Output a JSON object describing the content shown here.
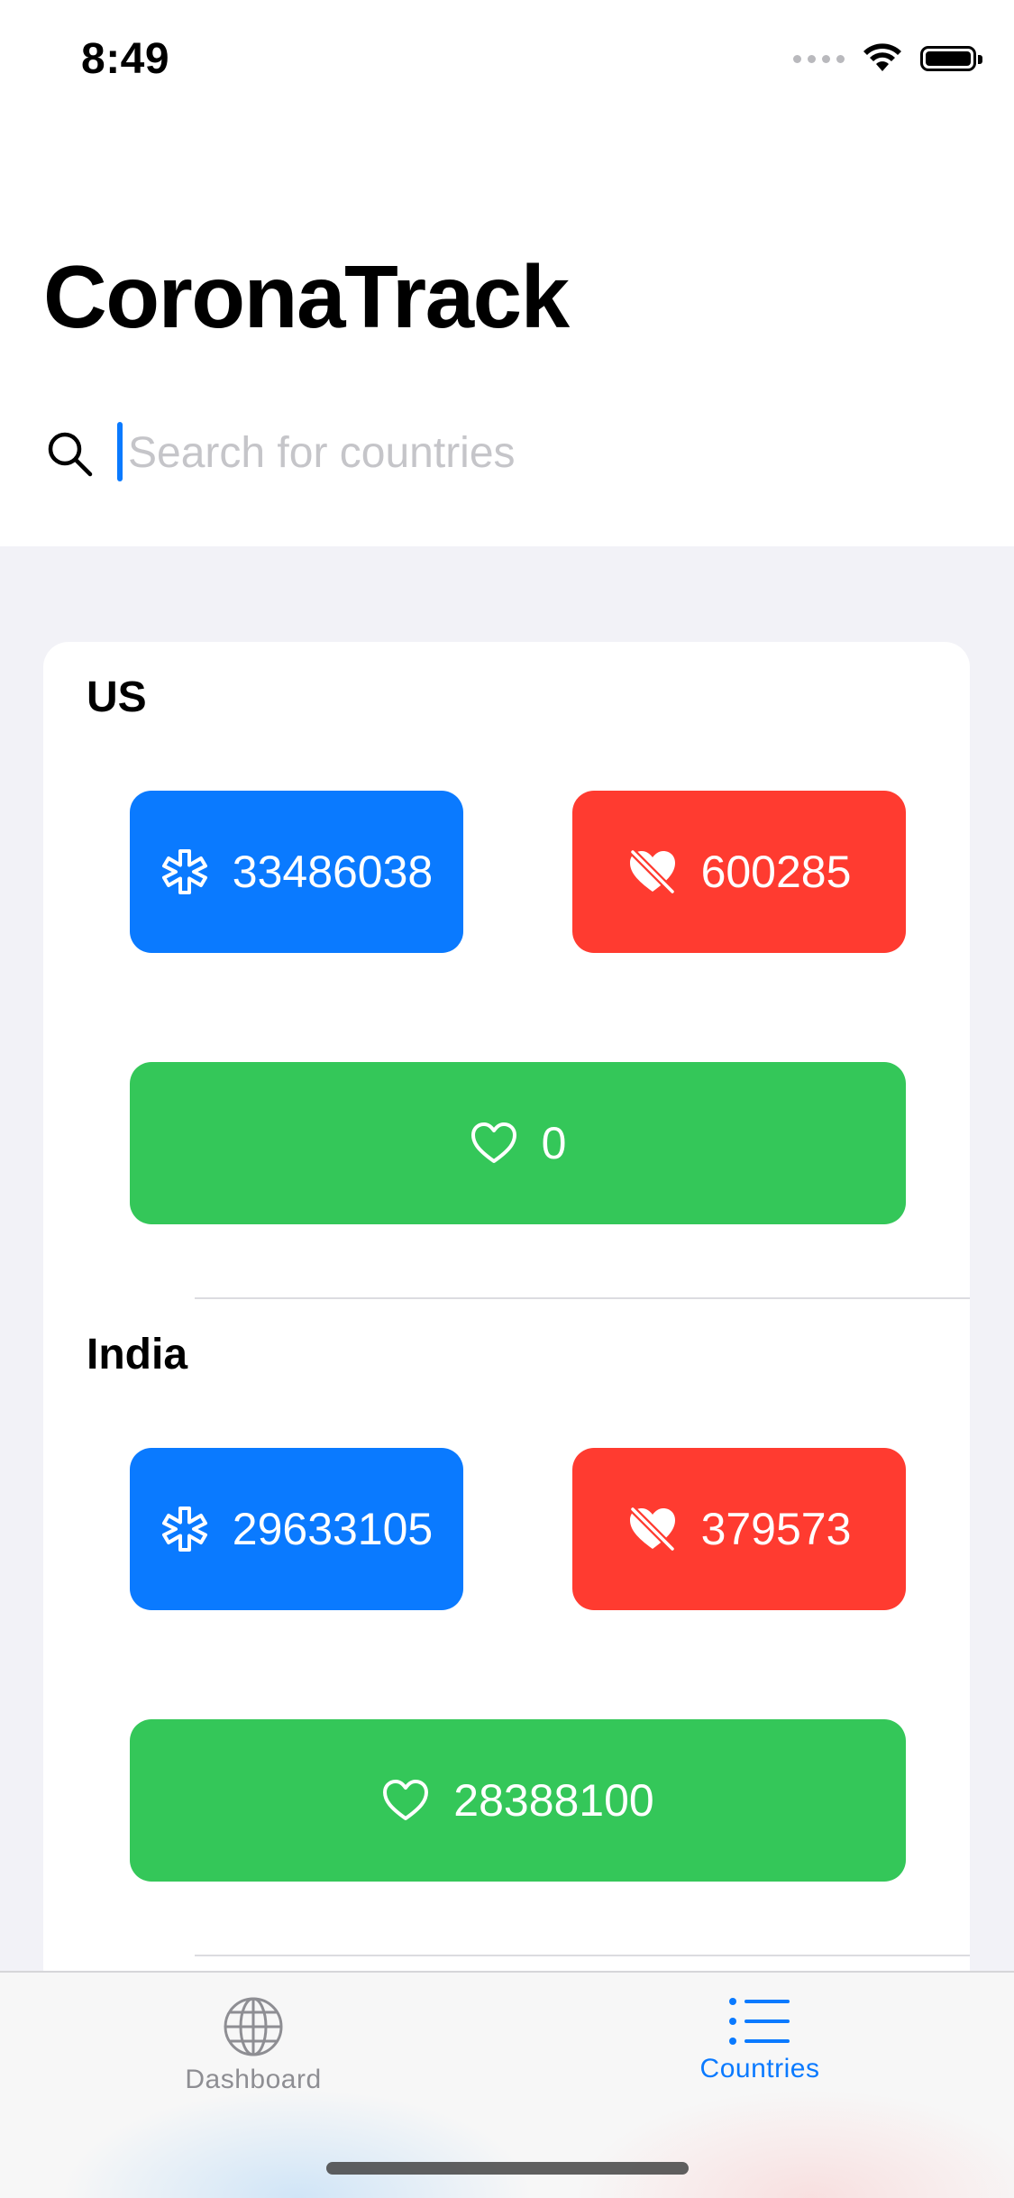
{
  "status_bar": {
    "time": "8:49"
  },
  "app": {
    "title": "CoronaTrack"
  },
  "search": {
    "placeholder": "Search for countries",
    "value": ""
  },
  "countries": [
    {
      "name": "US",
      "confirmed": "33486038",
      "deaths": "600285",
      "recovered": "0"
    },
    {
      "name": "India",
      "confirmed": "29633105",
      "deaths": "379573",
      "recovered": "28388100"
    }
  ],
  "colors": {
    "confirmed": "#0a7aff",
    "deaths": "#ff3b30",
    "recovered": "#34c759",
    "accent": "#0a7aff"
  },
  "icons": {
    "confirmed": "asterisk-medical-icon",
    "deaths": "heart-slash-icon",
    "recovered": "heart-icon"
  },
  "tab_bar": {
    "tabs": [
      {
        "label": "Dashboard",
        "icon": "globe-icon",
        "selected": false
      },
      {
        "label": "Countries",
        "icon": "list-icon",
        "selected": true
      }
    ]
  }
}
